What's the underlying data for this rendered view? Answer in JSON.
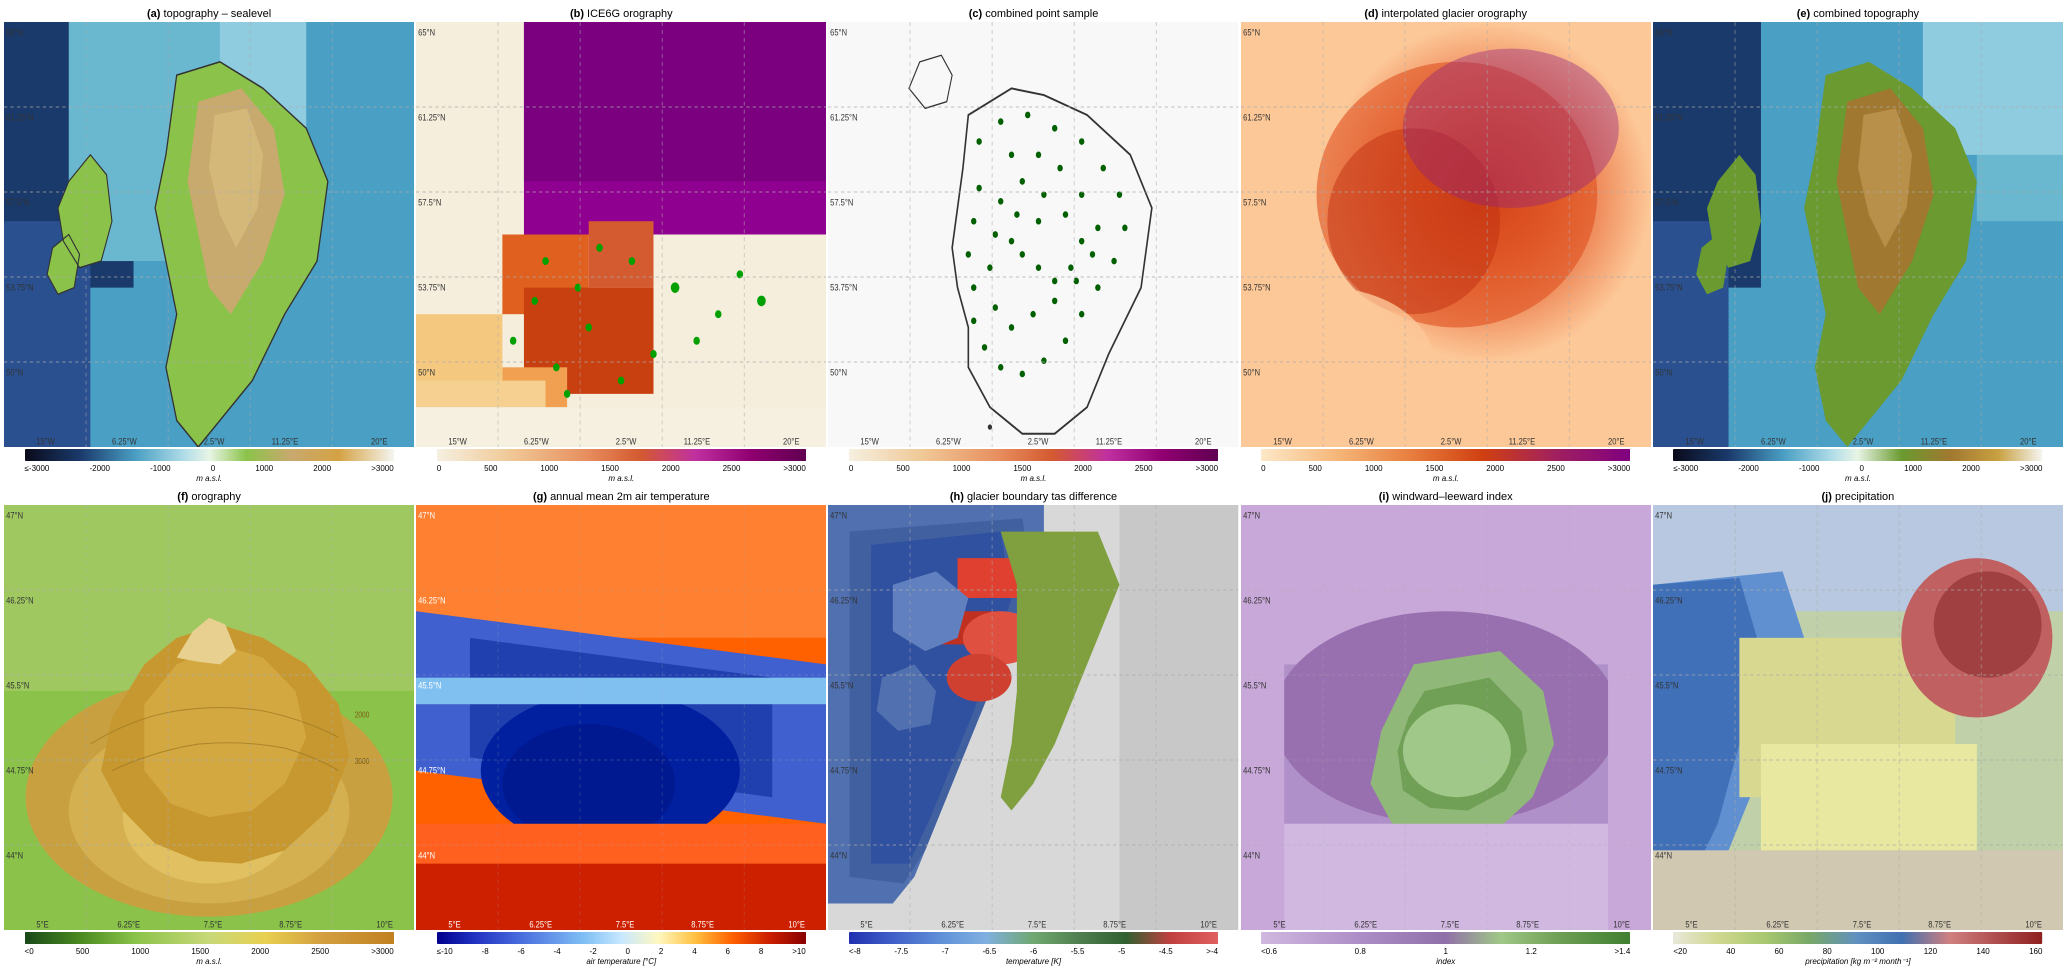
{
  "panels": {
    "row1": [
      {
        "id": "a",
        "label": "(a)",
        "title": "topography – sealevel",
        "colorbar": {
          "type": "diverging_topo",
          "stops": [
            "#0a0a1a",
            "#1a3a6b",
            "#4a9fc4",
            "#b0dce8",
            "#e8f5e5",
            "#c8e6a0",
            "#8bc34a",
            "#c8a96e",
            "#d4a244",
            "#e8c87a",
            "#f5f5dc",
            "#ffffff"
          ],
          "labels": [
            "≤-3000",
            "-2000",
            "-1000",
            "0",
            "1000",
            "2000",
            ">3000"
          ],
          "unit": "m a.s.l."
        },
        "map_colors": {
          "ocean_deep": "#1a3a6b",
          "ocean_mid": "#4a9fc4",
          "ocean_shallow": "#b0dce8",
          "land_low": "#8bc34a",
          "land_mid": "#c8a96e",
          "land_high": "#d4a244",
          "glacier": "#f5f5dc"
        }
      },
      {
        "id": "b",
        "label": "(b)",
        "title": "ICE6G orography",
        "colorbar": {
          "type": "sequential_warm",
          "stops": [
            "#f5f0e0",
            "#f0c896",
            "#e89060",
            "#d45a30",
            "#a020a0",
            "#600060"
          ],
          "labels": [
            "0",
            "500",
            "1000",
            "1500",
            "2000",
            "2500",
            ">3000"
          ],
          "unit": "m a.s.l."
        }
      },
      {
        "id": "c",
        "label": "(c)",
        "title": "combined point sample",
        "colorbar": {
          "type": "sequential_warm2",
          "stops": [
            "#f5f0e0",
            "#f0c896",
            "#e89060",
            "#d45a30",
            "#a020a0",
            "#600060"
          ],
          "labels": [
            "0",
            "500",
            "1000",
            "1500",
            "2000",
            "2500",
            ">3000"
          ],
          "unit": "m a.s.l."
        }
      },
      {
        "id": "d",
        "label": "(d)",
        "title": "interpolated glacier orography",
        "colorbar": {
          "type": "sequential_warm3",
          "stops": [
            "#fde8c8",
            "#f5b87a",
            "#e88040",
            "#d04010",
            "#a02060",
            "#800080"
          ],
          "labels": [
            "0",
            "500",
            "1000",
            "1500",
            "2000",
            "2500",
            ">3000"
          ],
          "unit": "m a.s.l."
        }
      },
      {
        "id": "e",
        "label": "(e)",
        "title": "combined topography",
        "colorbar": {
          "type": "diverging_topo2",
          "stops": [
            "#0a0a1a",
            "#1a3a6b",
            "#4a9fc4",
            "#b0dce8",
            "#e8f5e5",
            "#8bc34a",
            "#c8a96e",
            "#d4a244",
            "#f5f5dc",
            "#ffffff"
          ],
          "labels": [
            "≤-3000",
            "-2000",
            "-1000",
            "0",
            "1000",
            "2000",
            ">3000"
          ],
          "unit": "m a.s.l."
        }
      }
    ],
    "row2": [
      {
        "id": "f",
        "label": "(f)",
        "title": "orography",
        "colorbar": {
          "type": "sequential_green_yellow",
          "stops": [
            "#1a4a1a",
            "#4a8a20",
            "#8bc34a",
            "#c8d878",
            "#e8e870",
            "#f0d060",
            "#f5c040",
            "#e8a020"
          ],
          "labels": [
            "<0",
            "500",
            "1000",
            "1500",
            "2000",
            "2500",
            ">3000"
          ],
          "unit": "m a.s.l."
        }
      },
      {
        "id": "g",
        "label": "(g)",
        "title": "annual mean 2m air temperature",
        "colorbar": {
          "type": "diverging_temp",
          "stops": [
            "#00008b",
            "#4040c8",
            "#6080e0",
            "#80c0f0",
            "#c0e8ff",
            "#fff8c0",
            "#ffc040",
            "#ff6000",
            "#cc2000",
            "#880000"
          ],
          "labels": [
            "≤-10",
            "-8",
            "-6",
            "-4",
            "-2",
            "0",
            "2",
            "4",
            "6",
            "8",
            ">10"
          ],
          "unit": "air temperature [°C]"
        }
      },
      {
        "id": "h",
        "label": "(h)",
        "title": "glacier boundary tas difference",
        "colorbar": {
          "type": "diverging_bluegreen",
          "stops": [
            "#4040c0",
            "#6080d0",
            "#80b0e0",
            "#a0d0a0",
            "#60a060",
            "#408040",
            "#206020",
            "#c04040",
            "#e06060"
          ],
          "labels": [
            "<-8",
            "-7.5",
            "-7",
            "-6.5",
            "-6",
            "-5.5",
            "-5",
            "-4.5",
            ">-4"
          ],
          "unit": "temperature [K]"
        }
      },
      {
        "id": "i",
        "label": "(i)",
        "title": "windward–leeward index",
        "colorbar": {
          "type": "sequential_purple_green",
          "stops": [
            "#c8a0d8",
            "#b080c8",
            "#9060a8",
            "#704888",
            "#a0c890",
            "#80b870",
            "#60a850",
            "#409830"
          ],
          "labels": [
            "<0.6",
            "0.8",
            "1",
            "1.2",
            ">1.4"
          ],
          "unit": "index"
        }
      },
      {
        "id": "j",
        "label": "(j)",
        "title": "precipitation",
        "colorbar": {
          "type": "sequential_precip",
          "stops": [
            "#e8e8d0",
            "#d0d880",
            "#a0c860",
            "#80b8a0",
            "#60a8d0",
            "#4080c0",
            "#e0a0a0",
            "#c06060",
            "#a02020"
          ],
          "labels": [
            "<20",
            "40",
            "60",
            "80",
            "100",
            "120",
            "140",
            "160"
          ],
          "unit": "precipitation [kg m⁻² month⁻¹]"
        }
      }
    ]
  },
  "axes": {
    "row1_lon": [
      "15°W",
      "6.25°W",
      "2.5°W",
      "11.25°E",
      "20°E"
    ],
    "row1_lat": [
      "65°N",
      "61.25°N",
      "57.5°N",
      "53.75°N",
      "50°N"
    ],
    "row2_lon": [
      "5°E",
      "6.25°E",
      "7.5°E",
      "8.75°E",
      "10°E"
    ],
    "row2_lat": [
      "47°N",
      "46.25°N",
      "45.5°N",
      "44.75°N",
      "44°N"
    ]
  }
}
